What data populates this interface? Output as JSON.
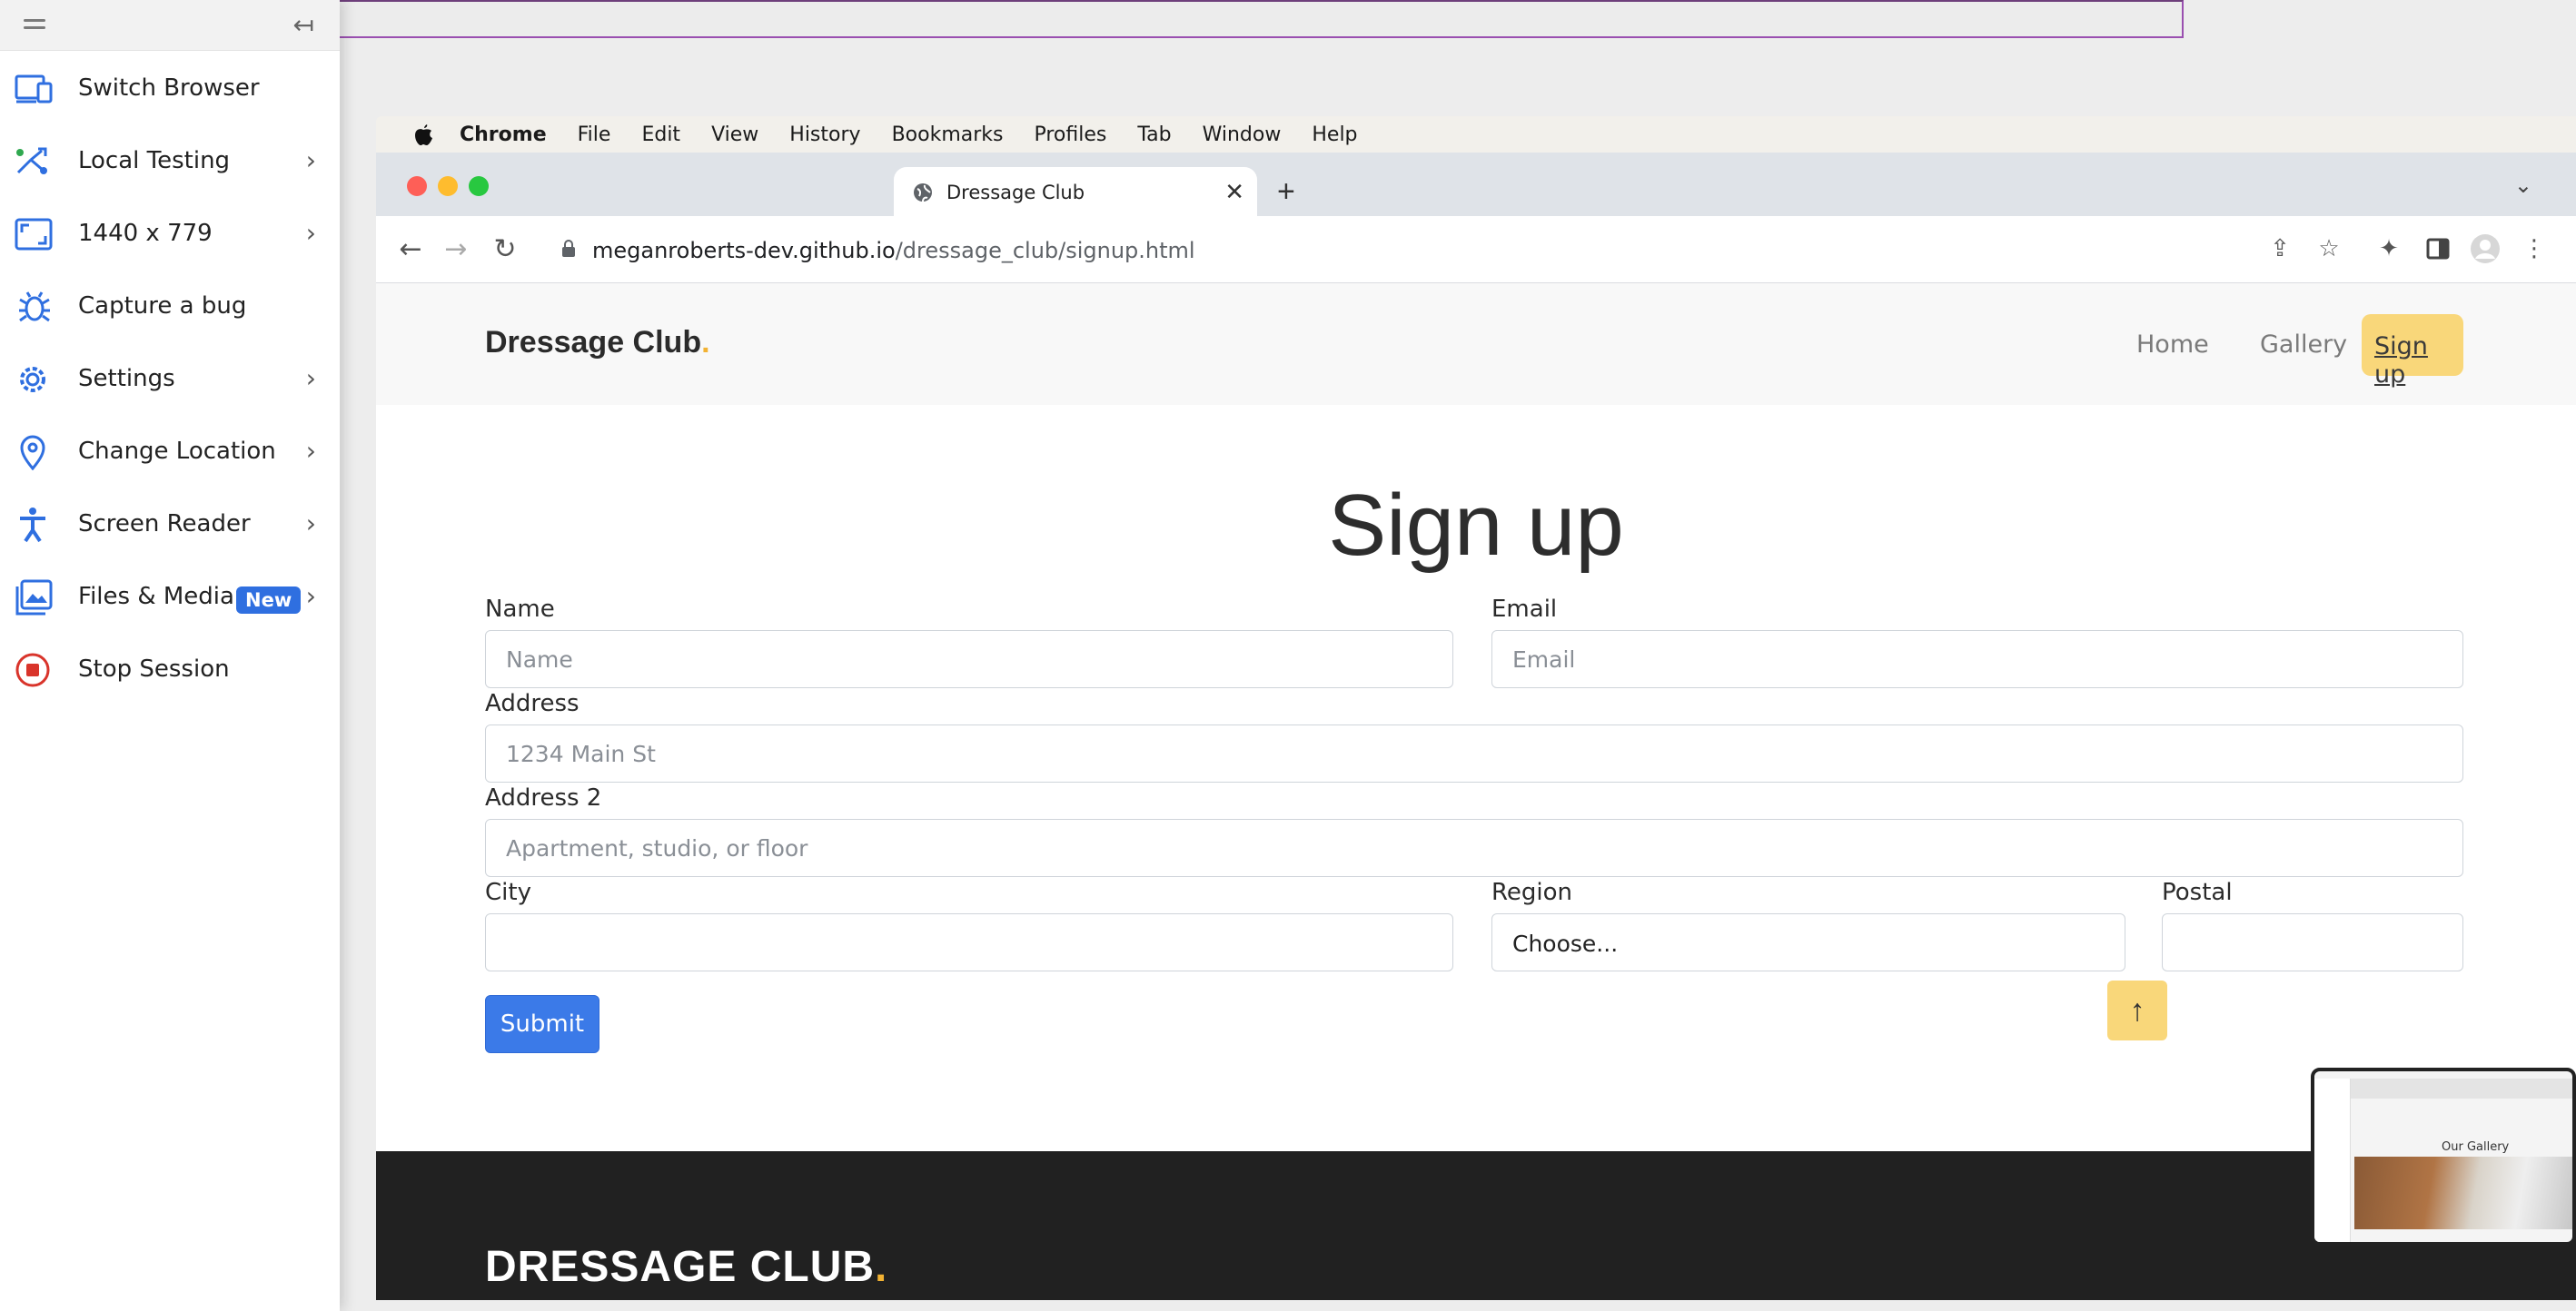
{
  "sidebar": {
    "items": [
      {
        "label": "Switch Browser",
        "has_chevron": false
      },
      {
        "label": "Local Testing",
        "has_chevron": true
      },
      {
        "label": "1440 x 779",
        "has_chevron": true
      },
      {
        "label": "Capture a bug",
        "has_chevron": false
      },
      {
        "label": "Settings",
        "has_chevron": true
      },
      {
        "label": "Change Location",
        "has_chevron": true
      },
      {
        "label": "Screen Reader",
        "has_chevron": true
      },
      {
        "label": "Files & Media",
        "badge": "New",
        "has_chevron": true
      },
      {
        "label": "Stop Session",
        "has_chevron": false
      }
    ],
    "accent_color": "#2f6fe0",
    "stop_color": "#d9342b"
  },
  "mac_menu": {
    "items": [
      "Chrome",
      "File",
      "Edit",
      "View",
      "History",
      "Bookmarks",
      "Profiles",
      "Tab",
      "Window",
      "Help"
    ]
  },
  "browser": {
    "tab_title": "Dressage Club",
    "url_host": "meganroberts-dev.github.io",
    "url_path": "/dressage_club/signup.html"
  },
  "site": {
    "brand": "Dressage Club",
    "brand_dot": ".",
    "nav": {
      "home": "Home",
      "gallery": "Gallery",
      "signup": "Sign up"
    },
    "page_title": "Sign up",
    "form": {
      "name_label": "Name",
      "name_placeholder": "Name",
      "email_label": "Email",
      "email_placeholder": "Email",
      "address_label": "Address",
      "address_placeholder": "1234 Main St",
      "address2_label": "Address 2",
      "address2_placeholder": "Apartment, studio, or floor",
      "city_label": "City",
      "region_label": "Region",
      "region_value": "Choose...",
      "postal_label": "Postal",
      "submit_label": "Submit"
    },
    "footer_brand": "DRESSAGE CLUB",
    "accent_yellow": "#f9d77a",
    "submit_color": "#3b7ae8"
  },
  "thumbnail": {
    "title": "Our Gallery"
  }
}
